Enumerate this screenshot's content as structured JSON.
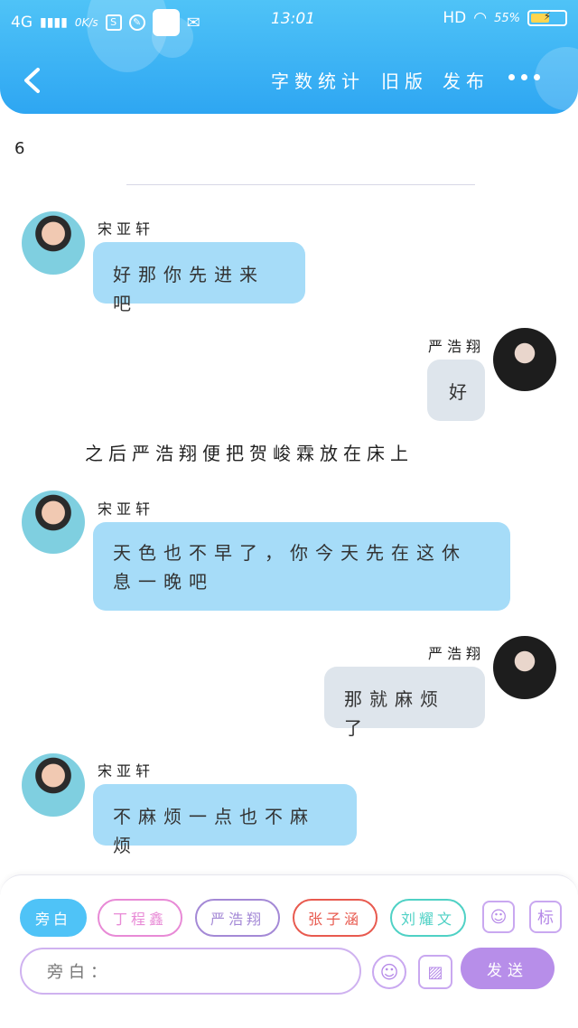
{
  "status_bar": {
    "network": "4G",
    "speed": "0K/s",
    "time": "13:01",
    "hd": "HD",
    "battery": "55%",
    "battery_level": 0.55
  },
  "header": {
    "tab_count": "字数统计",
    "tab_old": "旧版",
    "tab_publish": "发布"
  },
  "message_count": "6",
  "messages": [
    {
      "side": "left",
      "name": "宋亚轩",
      "text": "好那你先进来吧"
    },
    {
      "side": "right",
      "name": "严浩翔",
      "text": "好"
    },
    {
      "side": "narration",
      "text": "之后严浩翔便把贺峻霖放在床上"
    },
    {
      "side": "left",
      "name": "宋亚轩",
      "text": "天色也不早了，你今天先在这休息一晚吧"
    },
    {
      "side": "right",
      "name": "严浩翔",
      "text": "那就麻烦了"
    },
    {
      "side": "left",
      "name": "宋亚轩",
      "text": "不麻烦一点也不麻烦"
    }
  ],
  "composer": {
    "chips": [
      {
        "label": "旁白",
        "color": "#4fc3f7"
      },
      {
        "label": "丁程鑫",
        "color": "#e88ad6"
      },
      {
        "label": "严浩翔",
        "color": "#a489d6"
      },
      {
        "label": "张子涵",
        "color": "#e85a4f"
      },
      {
        "label": "刘耀文",
        "color": "#4fd1c5"
      }
    ],
    "icon_biao": "标",
    "input_placeholder": "旁白：",
    "send_label": "发送"
  }
}
